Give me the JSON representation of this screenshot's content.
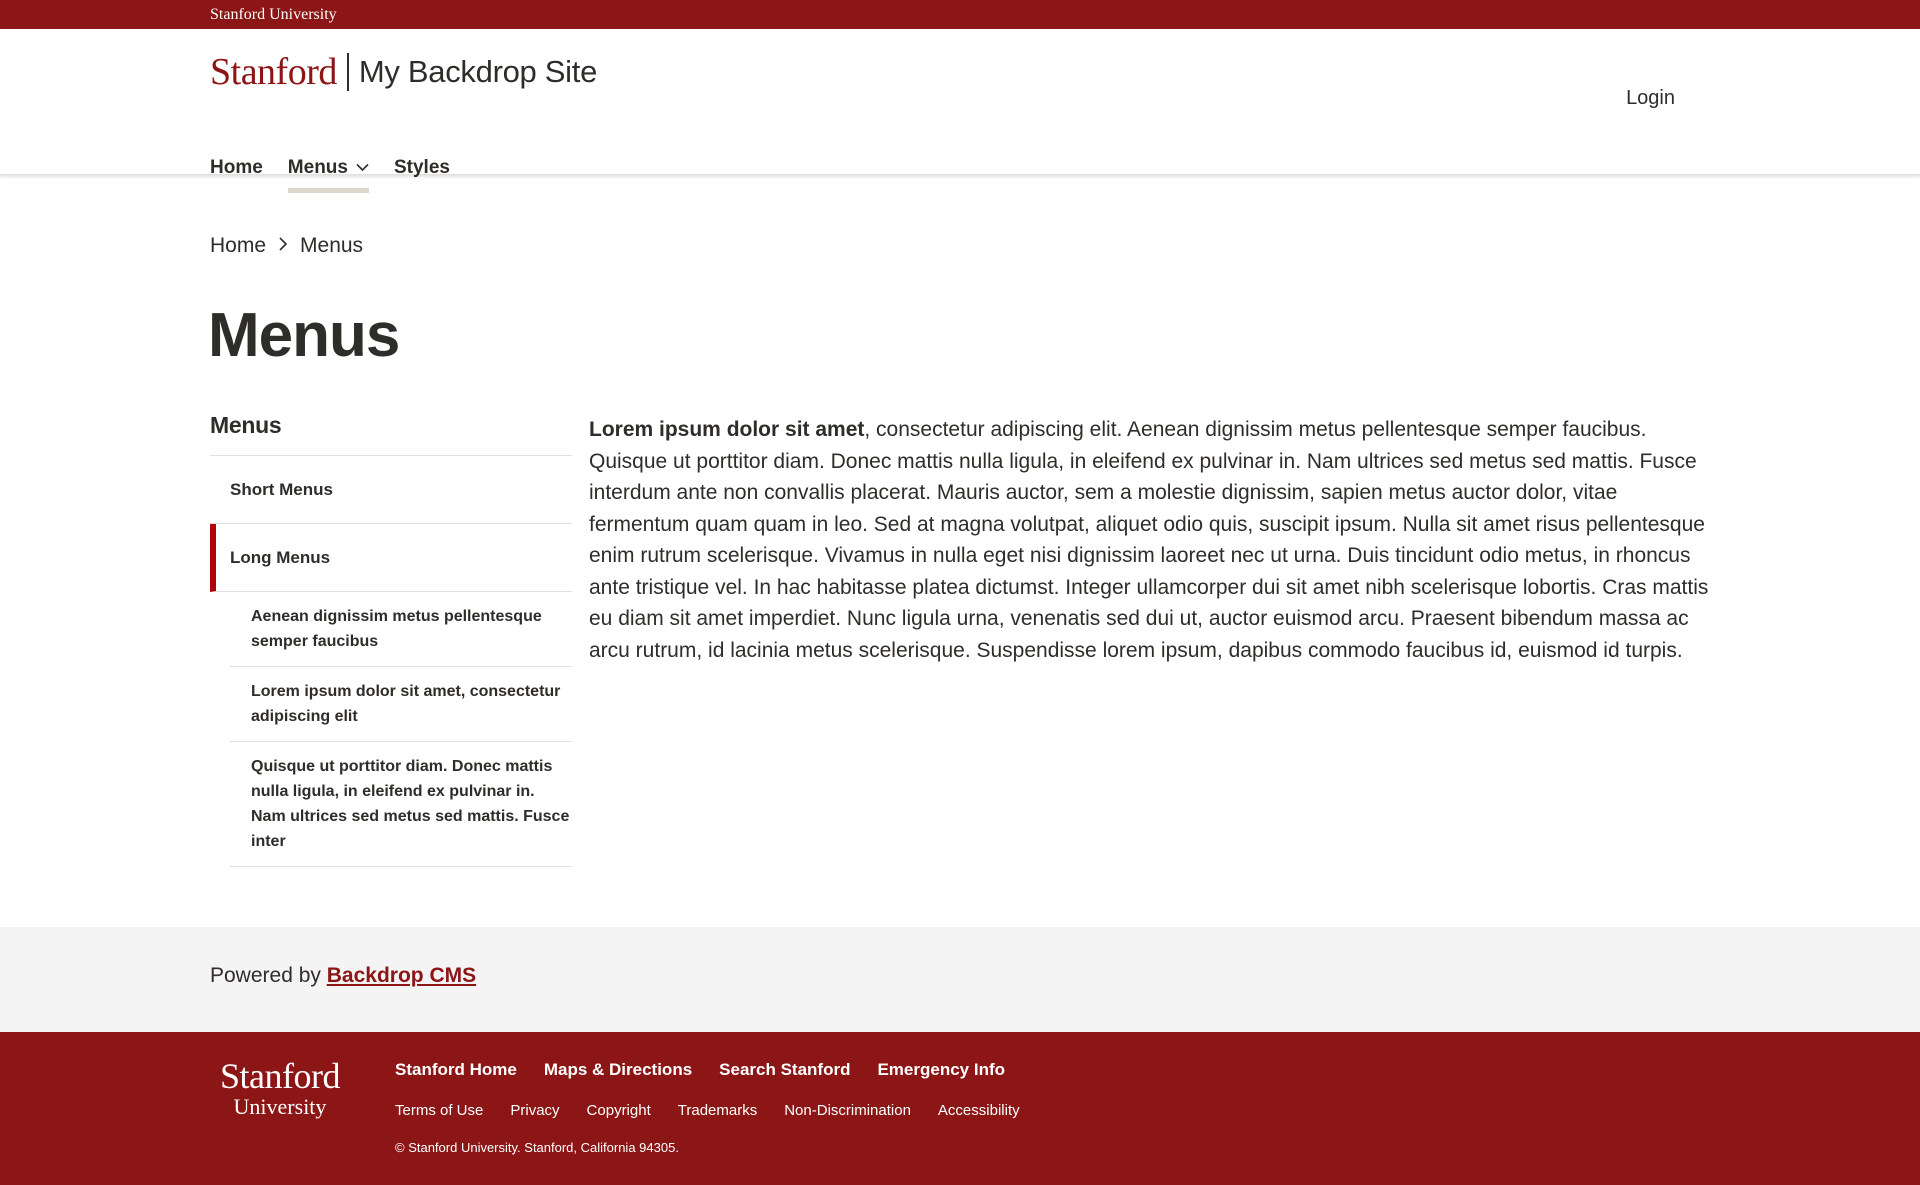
{
  "brandbar": {
    "label": "Stanford University"
  },
  "header": {
    "wordmark": "Stanford",
    "site_name": "My Backdrop Site",
    "login_label": "Login"
  },
  "mainnav": {
    "items": [
      {
        "label": "Home"
      },
      {
        "label": "Menus",
        "has_dropdown": true,
        "active": true
      },
      {
        "label": "Styles"
      }
    ]
  },
  "breadcrumb": {
    "items": [
      "Home",
      "Menus"
    ]
  },
  "page_title": "Menus",
  "sidebar": {
    "title": "Menus",
    "items": [
      {
        "label": "Short Menus"
      },
      {
        "label": "Long Menus",
        "active": true
      }
    ],
    "subitems": [
      {
        "label": "Aenean dignissim metus pellentesque semper faucibus"
      },
      {
        "label": "Lorem ipsum dolor sit amet, consectetur adipiscing elit"
      },
      {
        "label": "Quisque ut porttitor diam. Donec mattis nulla ligula, in eleifend ex pulvinar in. Nam ultrices sed metus sed mattis. Fusce inter"
      }
    ]
  },
  "content": {
    "lead_bold": "Lorem ipsum dolor sit amet",
    "text": ", consectetur adipiscing elit. Aenean dignissim metus pellentesque semper faucibus. Quisque ut porttitor diam. Donec mattis nulla ligula, in eleifend ex pulvinar in. Nam ultrices sed metus sed mattis. Fusce interdum ante non convallis placerat. Mauris auctor, sem a molestie dignissim, sapien metus auctor dolor, vitae fermentum quam quam in leo. Sed at magna volutpat, aliquet odio quis, suscipit ipsum. Nulla sit amet risus pellentesque enim rutrum scelerisque. Vivamus in nulla eget nisi dignissim laoreet nec ut urna. Duis tincidunt odio metus, in rhoncus ante tristique vel. In hac habitasse platea dictumst. Integer ullamcorper dui sit amet nibh scelerisque lobortis. Cras mattis eu diam sit amet imperdiet. Nunc ligula urna, venenatis sed dui ut, auctor euismod arcu. Praesent bibendum massa ac arcu rutrum, id lacinia metus scelerisque. Suspendisse lorem ipsum, dapibus commodo faucibus id, euismod id turpis."
  },
  "powered": {
    "prefix": "Powered by",
    "link": "Backdrop CMS"
  },
  "footer": {
    "logo_big": "Stanford",
    "logo_small": "University",
    "primary_links": [
      "Stanford Home",
      "Maps & Directions",
      "Search Stanford",
      "Emergency Info"
    ],
    "secondary_links": [
      "Terms of Use",
      "Privacy",
      "Copyright",
      "Trademarks",
      "Non-Discrimination",
      "Accessibility"
    ],
    "copyright": "© Stanford University.   Stanford, California 94305."
  },
  "colors": {
    "cardinal": "#8c1515",
    "active_indicator": "#b1040e",
    "text": "#2e2d29",
    "powered_bg": "#f4f4f4"
  }
}
